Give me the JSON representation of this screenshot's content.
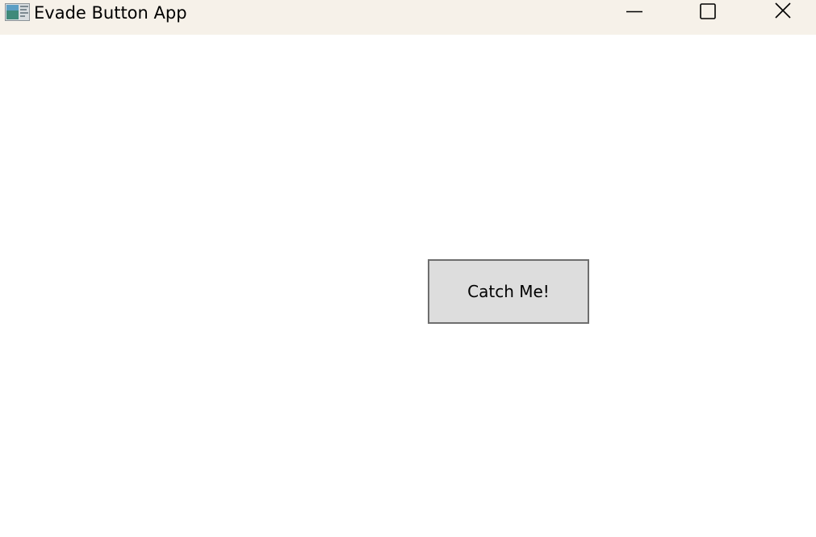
{
  "window": {
    "title": "Evade Button App",
    "app_icon": "app-window-icon",
    "controls": {
      "minimize_icon": "minimize-icon",
      "maximize_icon": "maximize-icon",
      "close_icon": "close-icon"
    }
  },
  "main": {
    "catch_button_label": "Catch Me!"
  },
  "colors": {
    "titlebar_bg": "#f6f1e9",
    "content_bg": "#ffffff",
    "button_bg": "#dddddd",
    "button_border": "#6e6e6e"
  }
}
